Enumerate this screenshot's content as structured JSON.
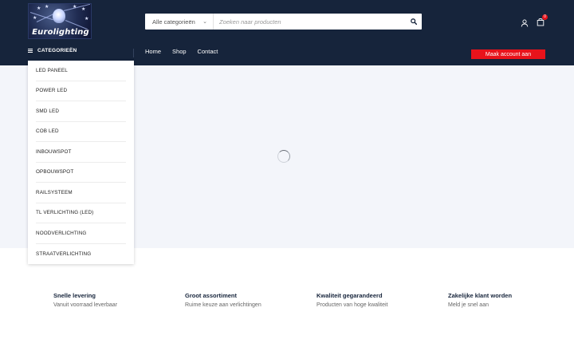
{
  "brand": {
    "logo_text": "Eurolighting"
  },
  "search": {
    "category_label": "Alle categorieën",
    "placeholder": "Zoeken naar producten",
    "value": ""
  },
  "header": {
    "cart_count": "0"
  },
  "catbar": {
    "label": "CATEGORIEËN"
  },
  "nav": {
    "items": [
      "Home",
      "Shop",
      "Contact"
    ]
  },
  "account_button": "Maak account aan",
  "categories": [
    "LED PANEEL",
    "POWER LED",
    "SMD LED",
    "COB LED",
    "INBOUWSPOT",
    "OPBOUWSPOT",
    "RAILSYSTEEM",
    "TL VERLICHTING (LED)",
    "NOODVERLICHTING",
    "STRAATVERLICHTING"
  ],
  "features": [
    {
      "title": "Snelle levering",
      "subtitle": "Vanuit voorraad leverbaar"
    },
    {
      "title": "Groot assortiment",
      "subtitle": "Ruime keuze aan verlichtingen"
    },
    {
      "title": "Kwaliteit gegarandeerd",
      "subtitle": "Producten van hoge kwaliteit"
    },
    {
      "title": "Zakelijke klant worden",
      "subtitle": "Meld je snel aan"
    }
  ],
  "colors": {
    "header_bg": "#16243b",
    "accent_red": "#e8131b",
    "hero_bg": "#f3f5fa"
  }
}
